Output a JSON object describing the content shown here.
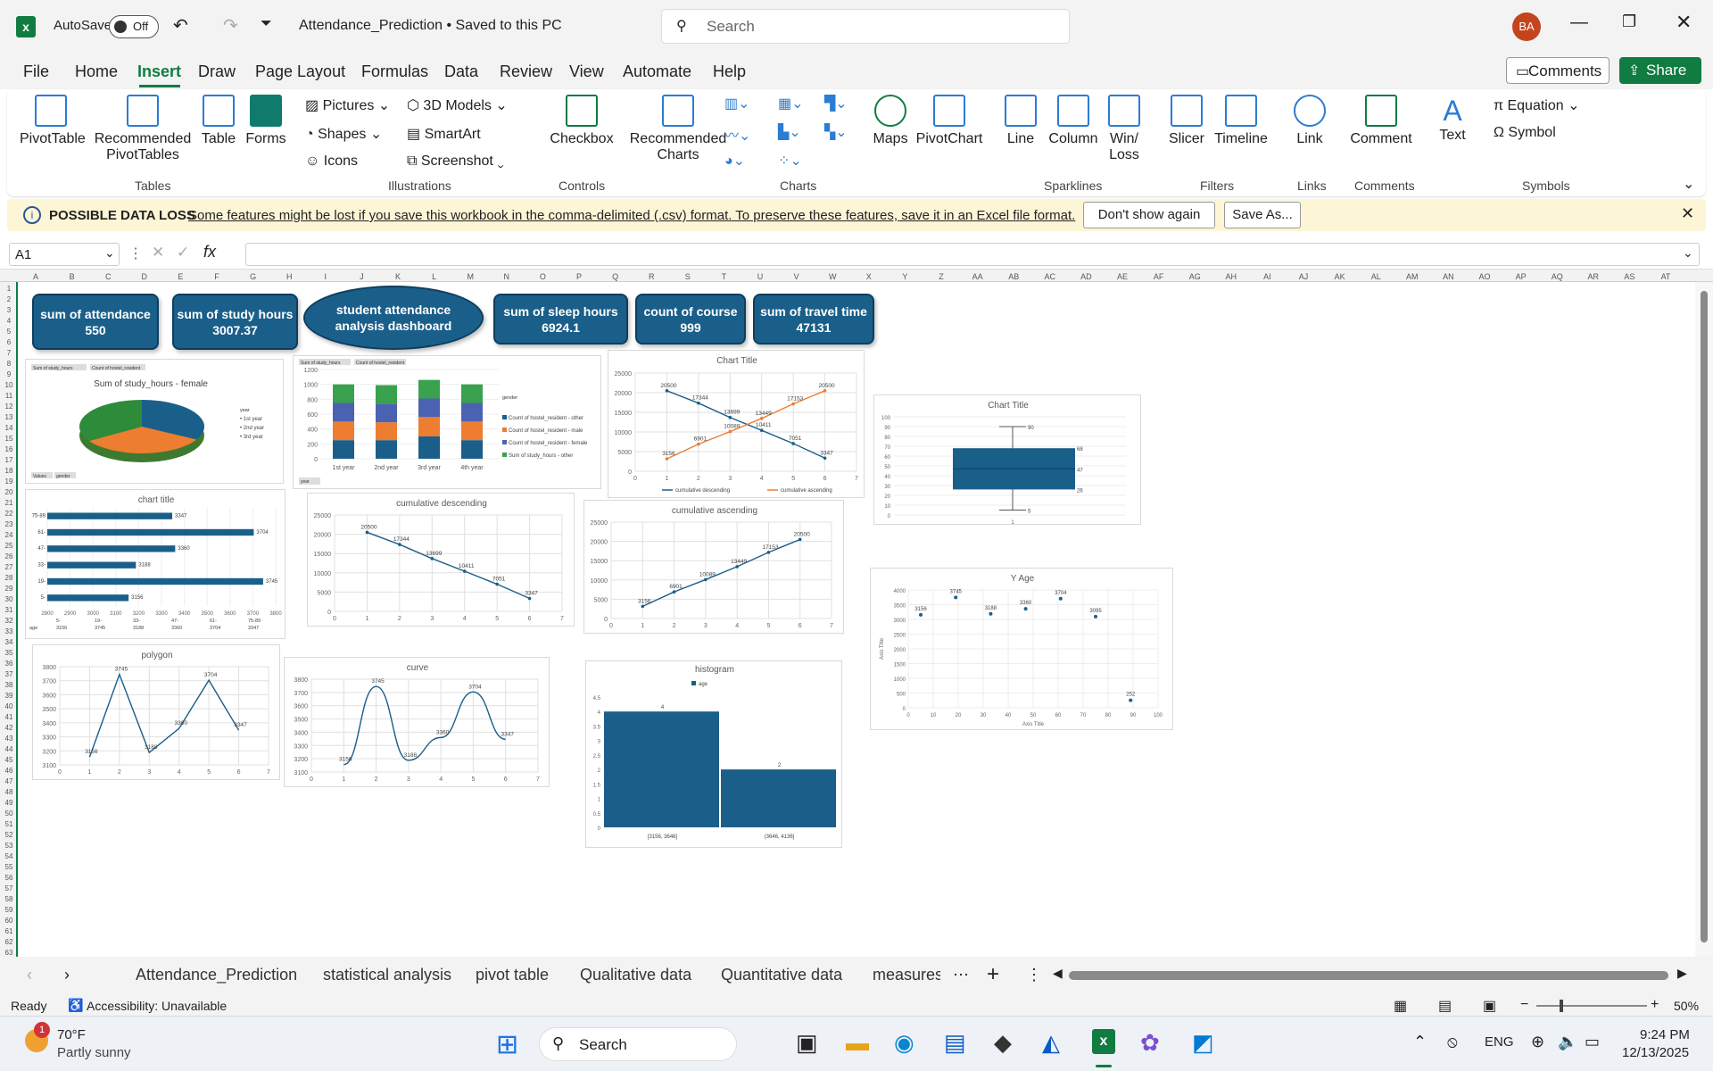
{
  "titlebar": {
    "autosave": "AutoSave",
    "autosave_state": "Off",
    "doc_title": "Attendance_Prediction • Saved to this PC",
    "search_placeholder": "Search",
    "avatar": "BA"
  },
  "tabs": [
    "File",
    "Home",
    "Insert",
    "Draw",
    "Page Layout",
    "Formulas",
    "Data",
    "Review",
    "View",
    "Automate",
    "Help"
  ],
  "active_tab": "Insert",
  "comments_label": "Comments",
  "share_label": "Share",
  "ribbon": {
    "pivottable": "PivotTable",
    "recommended_pivot": "Recommended PivotTables",
    "table": "Table",
    "forms": "Forms",
    "pictures": "Pictures",
    "shapes": "Shapes",
    "icons": "Icons",
    "models3d": "3D Models",
    "smartart": "SmartArt",
    "screenshot": "Screenshot",
    "checkbox": "Checkbox",
    "rec_charts": "Recommended Charts",
    "maps": "Maps",
    "pivotchart": "PivotChart",
    "line": "Line",
    "column": "Column",
    "winloss": "Win/ Loss",
    "slicer": "Slicer",
    "timeline": "Timeline",
    "link": "Link",
    "comment": "Comment",
    "text": "Text",
    "equation": "Equation",
    "symbol": "Symbol",
    "groups": {
      "tables": "Tables",
      "illustrations": "Illustrations",
      "controls": "Controls",
      "charts": "Charts",
      "sparklines": "Sparklines",
      "filters": "Filters",
      "links": "Links",
      "comments": "Comments",
      "symbols": "Symbols"
    }
  },
  "infobar": {
    "title": "POSSIBLE DATA LOSS",
    "message": "Some features might be lost if you save this workbook in the comma-delimited (.csv) format. To preserve these features, save it in an Excel file format.",
    "dont_show": "Don't show again",
    "save_as": "Save As..."
  },
  "formula_bar": {
    "name_box": "A1",
    "fx": "fx",
    "value": ""
  },
  "columns": [
    "A",
    "B",
    "C",
    "D",
    "E",
    "F",
    "G",
    "H",
    "I",
    "J",
    "K",
    "L",
    "M",
    "N",
    "O",
    "P",
    "Q",
    "R",
    "S",
    "T",
    "U",
    "V",
    "W",
    "X",
    "Y",
    "Z",
    "AA",
    "AB",
    "AC",
    "AD",
    "AE",
    "AF",
    "AG",
    "AH",
    "AI",
    "AJ",
    "AK",
    "AL",
    "AM",
    "AN",
    "AO",
    "AP",
    "AQ",
    "AR",
    "AS",
    "AT"
  ],
  "cards": [
    {
      "label": "sum of attendance",
      "value": "550"
    },
    {
      "label": "sum of study hours",
      "value": "3007.37"
    },
    {
      "label": "student attendance analysis dashboard",
      "value": ""
    },
    {
      "label": "sum of sleep hours",
      "value": "6924.1"
    },
    {
      "label": "count of course",
      "value": "999"
    },
    {
      "label": "sum of travel time",
      "value": "47131"
    }
  ],
  "chart_data": [
    {
      "id": "pie",
      "type": "pie",
      "title": "Sum of study_hours - female",
      "categories": [
        "1st year",
        "2nd year",
        "3rd year"
      ],
      "values": [
        33,
        33,
        34
      ],
      "legend_title": "year",
      "field_buttons": [
        "Sum of study_hours",
        "Count of hostel_resident",
        "Values",
        "gender"
      ]
    },
    {
      "id": "stacked",
      "type": "bar",
      "stacked": true,
      "categories": [
        "1st year",
        "2nd year",
        "3rd year",
        "4th year"
      ],
      "series": [
        {
          "name": "Count of hostel_resident - other",
          "values": [
            250,
            250,
            250,
            250
          ]
        },
        {
          "name": "Count of hostel_resident - male",
          "values": [
            250,
            250,
            250,
            250
          ]
        },
        {
          "name": "Count of hostel_resident - female",
          "values": [
            250,
            240,
            260,
            250
          ]
        },
        {
          "name": "Sum of study_hours - other",
          "values": [
            250,
            250,
            300,
            250
          ]
        }
      ],
      "ylim": [
        0,
        1200
      ],
      "yticks": [
        0,
        200,
        400,
        600,
        800,
        1000,
        1200
      ],
      "legend_title": "gender",
      "field_buttons": [
        "Sum of study_hours",
        "Count of hostel_resident",
        "Values",
        "year"
      ]
    },
    {
      "id": "chart1",
      "type": "line",
      "title": "Chart Title",
      "x": [
        1,
        2,
        3,
        4,
        5,
        6
      ],
      "series": [
        {
          "name": "cumulative descending",
          "values": [
            20500,
            17344,
            13699,
            10411,
            7051,
            3347
          ]
        },
        {
          "name": "cumulative ascending",
          "values": [
            3156,
            6901,
            10089,
            13449,
            17153,
            20500
          ]
        }
      ],
      "xlim": [
        0,
        7
      ],
      "ylim": [
        0,
        25000
      ]
    },
    {
      "id": "box",
      "type": "box",
      "title": "Chart Title",
      "min": 5,
      "q1": 26,
      "median": 47,
      "q3": 68,
      "max": 90,
      "ylim": [
        0,
        100
      ],
      "yticks": [
        0,
        10,
        20,
        30,
        40,
        50,
        60,
        70,
        80,
        90,
        100
      ],
      "xlabel": "1",
      "labels": [
        "90",
        "68",
        "47",
        "26",
        "5"
      ]
    },
    {
      "id": "hbar",
      "type": "bar",
      "horizontal": true,
      "title": "chart title",
      "categories": [
        "5-",
        "19-",
        "33-",
        "47-",
        "61-",
        "75-89"
      ],
      "values": [
        3156,
        3745,
        3188,
        3360,
        3704,
        3347
      ],
      "xlim": [
        2800,
        3800
      ],
      "xticks": [
        2800,
        2900,
        3000,
        3100,
        3200,
        3300,
        3400,
        3500,
        3600,
        3700,
        3800
      ],
      "series_name": "age"
    },
    {
      "id": "cdesc",
      "type": "line",
      "title": "cumulative descending",
      "x": [
        1,
        2,
        3,
        4,
        5,
        6
      ],
      "values": [
        20500,
        17344,
        13699,
        10411,
        7051,
        3347
      ],
      "xlim": [
        0,
        7
      ],
      "ylim": [
        0,
        25000
      ]
    },
    {
      "id": "casc",
      "type": "line",
      "title": "cumulative ascending",
      "x": [
        1,
        2,
        3,
        4,
        5,
        6
      ],
      "values": [
        3156,
        6901,
        10089,
        13449,
        17153,
        20500
      ],
      "xlim": [
        0,
        7
      ],
      "ylim": [
        0,
        25000
      ]
    },
    {
      "id": "scatter",
      "type": "scatter",
      "title": "Y Age",
      "xlabel": "Axis Title",
      "ylabel": "Axis Title",
      "x": [
        5,
        19,
        33,
        47,
        61,
        75,
        89
      ],
      "values": [
        3156,
        3745,
        3188,
        3360,
        3704,
        3095,
        252
      ],
      "xlim": [
        0,
        100
      ],
      "ylim": [
        0,
        4000
      ]
    },
    {
      "id": "polygon",
      "type": "line",
      "title": "polygon",
      "x": [
        1,
        2,
        3,
        4,
        5,
        6
      ],
      "values": [
        3156,
        3745,
        3188,
        3360,
        3704,
        3347
      ],
      "xlim": [
        0,
        7
      ],
      "ylim": [
        3100,
        3800
      ]
    },
    {
      "id": "curve",
      "type": "line",
      "smooth": true,
      "title": "curve",
      "x": [
        1,
        2,
        3,
        4,
        5,
        6
      ],
      "values": [
        3156,
        3745,
        3188,
        3360,
        3704,
        3347
      ],
      "xlim": [
        0,
        7
      ],
      "ylim": [
        3100,
        3800
      ]
    },
    {
      "id": "hist",
      "type": "bar",
      "title": "histogram",
      "categories": [
        "[3156, 3646]",
        "(3646, 4136]"
      ],
      "values": [
        4,
        2
      ],
      "ylim": [
        0,
        4.5
      ],
      "yticks": [
        0,
        0.5,
        1,
        1.5,
        2,
        2.5,
        3,
        3.5,
        4,
        4.5
      ],
      "series_name": "age"
    }
  ],
  "sheets": [
    "Attendance_Prediction",
    "statistical analysis",
    "pivot table",
    "Qualitative data",
    "Quantitative data",
    "measures"
  ],
  "status": {
    "ready": "Ready",
    "accessibility": "Accessibility: Unavailable",
    "zoom": "50%"
  },
  "taskbar": {
    "temp": "70°F",
    "weather": "Partly sunny",
    "badge": "1",
    "search": "Search",
    "lang": "ENG",
    "time": "9:24 PM",
    "date": "12/13/2025"
  },
  "colors": {
    "accent": "#107c41",
    "blue": "#1a5f8a",
    "orange": "#ed7d31",
    "green": "#2e8b3a"
  }
}
